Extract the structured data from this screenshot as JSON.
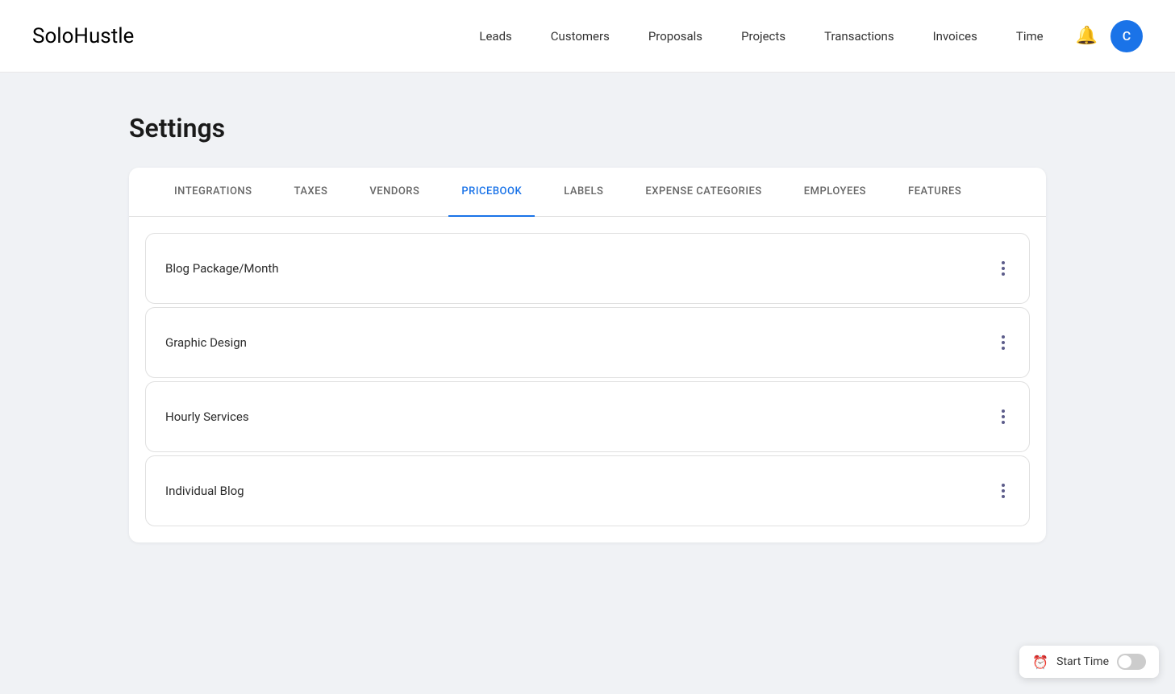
{
  "app": {
    "logo_bold": "Solo",
    "logo_light": "Hustle"
  },
  "nav": {
    "items": [
      {
        "label": "Leads",
        "id": "leads"
      },
      {
        "label": "Customers",
        "id": "customers"
      },
      {
        "label": "Proposals",
        "id": "proposals"
      },
      {
        "label": "Projects",
        "id": "projects"
      },
      {
        "label": "Transactions",
        "id": "transactions"
      },
      {
        "label": "Invoices",
        "id": "invoices"
      },
      {
        "label": "Time",
        "id": "time"
      }
    ]
  },
  "header": {
    "avatar_letter": "C"
  },
  "page": {
    "title": "Settings"
  },
  "settings": {
    "tabs": [
      {
        "label": "INTEGRATIONS",
        "id": "integrations",
        "active": false
      },
      {
        "label": "TAXES",
        "id": "taxes",
        "active": false
      },
      {
        "label": "VENDORS",
        "id": "vendors",
        "active": false
      },
      {
        "label": "PRICEBOOK",
        "id": "pricebook",
        "active": true
      },
      {
        "label": "LABELS",
        "id": "labels",
        "active": false
      },
      {
        "label": "EXPENSE CATEGORIES",
        "id": "expense-categories",
        "active": false
      },
      {
        "label": "EMPLOYEES",
        "id": "employees",
        "active": false
      },
      {
        "label": "FEATURES",
        "id": "features",
        "active": false
      }
    ],
    "pricebook_items": [
      {
        "name": "Blog Package/Month",
        "id": "item-1"
      },
      {
        "name": "Graphic Design",
        "id": "item-2"
      },
      {
        "name": "Hourly Services",
        "id": "item-3"
      },
      {
        "name": "Individual Blog",
        "id": "item-4"
      }
    ]
  },
  "bottom_bar": {
    "label": "Start Time"
  }
}
